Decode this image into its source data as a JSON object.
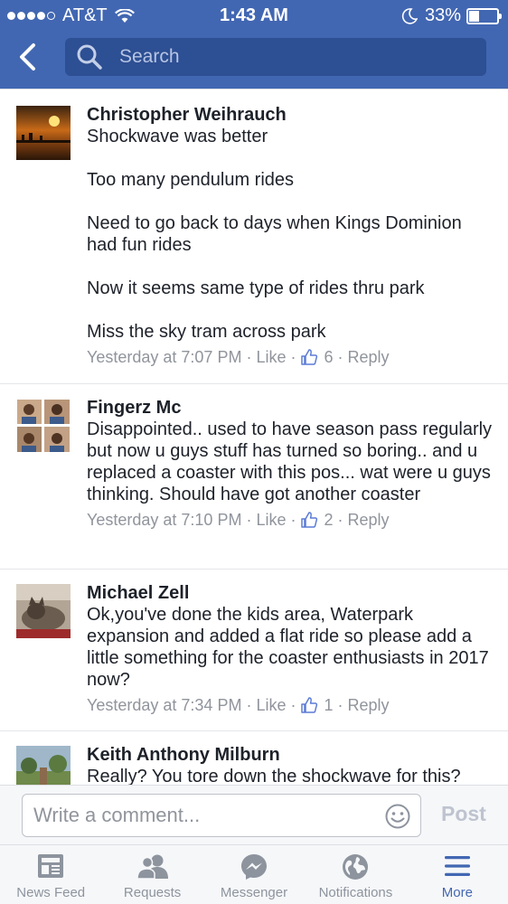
{
  "status_bar": {
    "carrier": "AT&T",
    "time": "1:43 AM",
    "battery_percent": "33%",
    "battery_level": 0.33
  },
  "header": {
    "search_placeholder": "Search",
    "back_icon": "chevron-left-icon",
    "search_icon": "magnifier-icon"
  },
  "comments": [
    {
      "author": "Christopher Weihrauch",
      "text": "Shockwave was better\n\nToo many pendulum rides\n\nNeed to go back to days when Kings Dominion had fun rides\n\nNow it seems same type of rides thru park\n\nMiss the sky tram across park",
      "time": "Yesterday at 7:07 PM",
      "like_label": "Like",
      "like_count": "6",
      "reply_label": "Reply"
    },
    {
      "author": "Fingerz Mc",
      "text": "Disappointed.. used to have season pass regularly but now u guys stuff has turned so boring.. and u replaced a coaster with this pos... wat were u guys thinking. Should have got another coaster",
      "time": "Yesterday at 7:10 PM",
      "like_label": "Like",
      "like_count": "2",
      "reply_label": "Reply"
    },
    {
      "author": "Michael Zell",
      "text": "Ok,you've done the kids area, Waterpark expansion  and added a flat ride  so please add a little something for the coaster enthusiasts in 2017 now?",
      "time": "Yesterday at 7:34 PM",
      "like_label": "Like",
      "like_count": "1",
      "reply_label": "Reply"
    },
    {
      "author": "Keith Anthony Milburn",
      "text": "Really? You tore down the shockwave for this?"
    }
  ],
  "compose": {
    "placeholder": "Write a comment...",
    "post_label": "Post"
  },
  "tabs": [
    {
      "label": "News Feed",
      "icon": "news-feed-icon"
    },
    {
      "label": "Requests",
      "icon": "friend-requests-icon"
    },
    {
      "label": "Messenger",
      "icon": "messenger-icon"
    },
    {
      "label": "Notifications",
      "icon": "globe-icon"
    },
    {
      "label": "More",
      "icon": "menu-icon",
      "active": true
    }
  ],
  "colors": {
    "brand_blue": "#4267b2",
    "search_bg": "#2d4f93",
    "meta_gray": "#90949c",
    "text_dark": "#1d2129"
  }
}
